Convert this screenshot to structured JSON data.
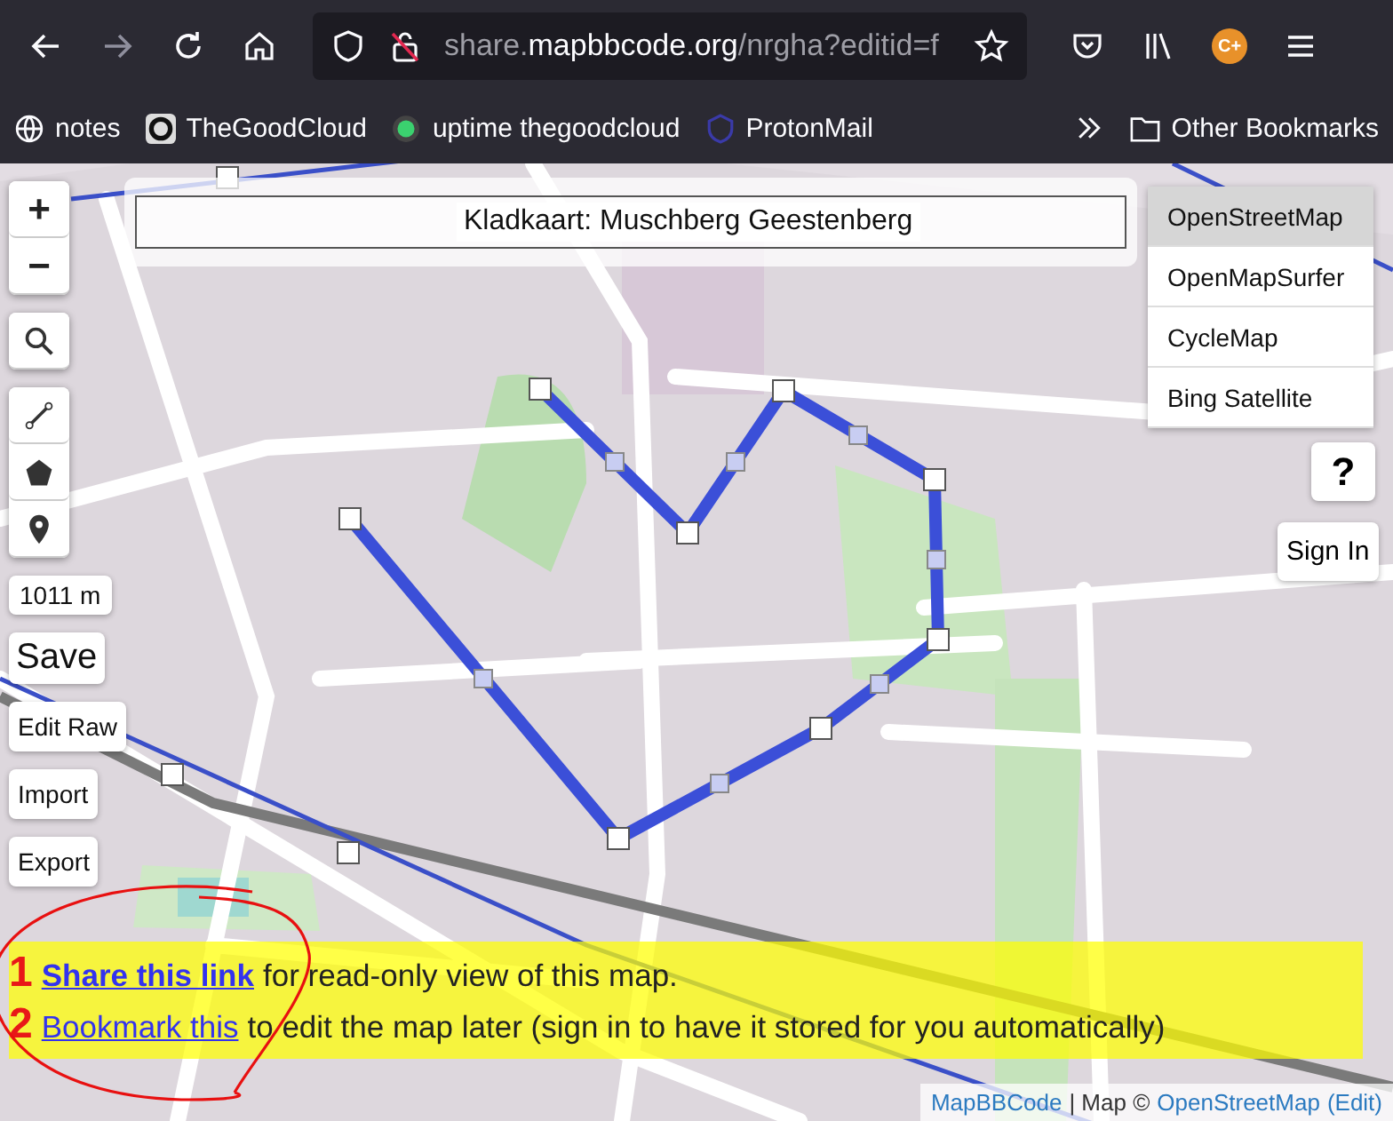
{
  "browser": {
    "url": "share.**mapbbcode.org**/nrgha?editid=f",
    "bookmarks": [
      {
        "label": "notes"
      },
      {
        "label": "TheGoodCloud"
      },
      {
        "label": "uptime thegoodcloud"
      },
      {
        "label": "ProtonMail"
      }
    ],
    "other_bookmarks": "Other Bookmarks",
    "account_badge": "C+"
  },
  "map": {
    "title": "Kladkaart: Muschberg Geestenberg",
    "zoom_in": "+",
    "zoom_out": "−",
    "distance": "1011 m",
    "actions": [
      {
        "label": "Save",
        "kind": "primary"
      },
      {
        "label": "Edit Raw",
        "kind": "plain"
      },
      {
        "label": "Import",
        "kind": "plain"
      },
      {
        "label": "Export",
        "kind": "plain"
      }
    ],
    "layers": [
      {
        "label": "OpenStreetMap",
        "selected": true
      },
      {
        "label": "OpenMapSurfer",
        "selected": false
      },
      {
        "label": "CycleMap",
        "selected": false
      },
      {
        "label": "Bing Satellite",
        "selected": false
      }
    ],
    "help": "?",
    "sign_in": "Sign In",
    "share_lines": [
      {
        "number": "1",
        "link": "Share this link",
        "bold": true,
        "text": "for read-only view of this map."
      },
      {
        "number": "2",
        "link": "Bookmark this",
        "bold": false,
        "text": "to edit the map later (sign in to have it stored for you automatically)"
      }
    ],
    "attribution": {
      "site": "MapBBCode",
      "separator": "| Map ©",
      "provider": "OpenStreetMap",
      "edit": "(Edit)"
    }
  }
}
